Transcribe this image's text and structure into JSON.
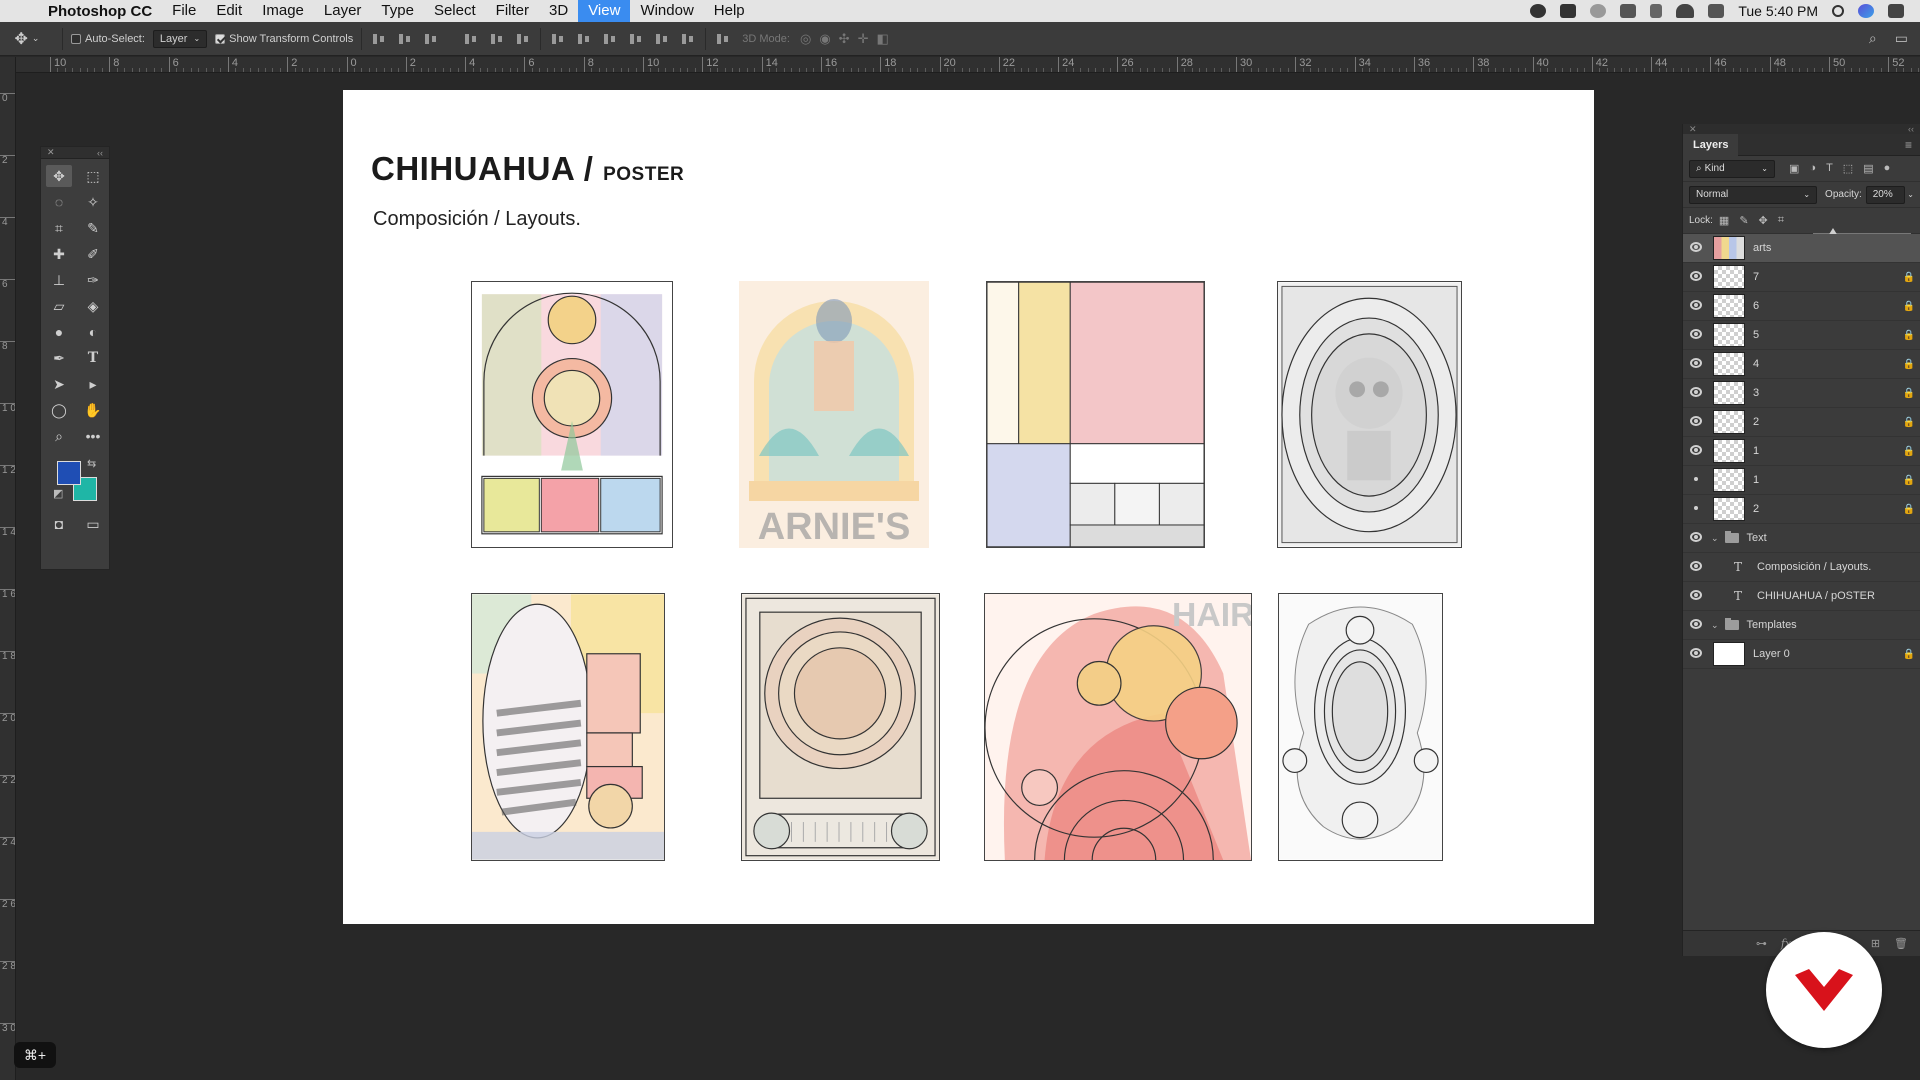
{
  "menubar": {
    "app_name": "Photoshop CC",
    "menus": [
      "File",
      "Edit",
      "Image",
      "Layer",
      "Type",
      "Select",
      "Filter",
      "3D",
      "View",
      "Window",
      "Help"
    ],
    "active_menu": "View",
    "clock": "Tue 5:40 PM"
  },
  "options_bar": {
    "auto_select_label": "Auto-Select:",
    "auto_select_target": "Layer",
    "show_transform_label": "Show Transform Controls",
    "mode_3d_label": "3D Mode:"
  },
  "rulers": {
    "horizontal_labels": [
      "10",
      "8",
      "6",
      "4",
      "2",
      "0",
      "2",
      "4",
      "6",
      "8",
      "10",
      "12",
      "14",
      "16",
      "18",
      "20",
      "22",
      "24",
      "26",
      "28",
      "30",
      "32",
      "34",
      "36",
      "38",
      "40",
      "42",
      "44",
      "46",
      "48",
      "50",
      "52"
    ],
    "vertical_labels": [
      "0",
      "2",
      "4",
      "6",
      "8",
      "1 0",
      "1 2",
      "1 4",
      "1 6",
      "1 8",
      "2 0",
      "2 2",
      "2 4",
      "2 6",
      "2 8",
      "3 0",
      "3 2"
    ]
  },
  "document": {
    "title_main": "CHIHUAHUA / ",
    "title_small": "POSTER",
    "subtitle": "Composición / Layouts.",
    "poster_text_arnies": "ARNIE'S",
    "poster_text_hair": "HAIR"
  },
  "layers_panel": {
    "tab_label": "Layers",
    "filter_kind": "Kind",
    "blend_mode": "Normal",
    "opacity_label": "Opacity:",
    "opacity_value": "20%",
    "opacity_fraction": 0.2,
    "lock_label": "Lock:",
    "layers": [
      {
        "name": "arts",
        "visible": true,
        "locked": false,
        "selected": true,
        "kind": "image"
      },
      {
        "name": "7",
        "visible": true,
        "locked": true,
        "kind": "pixel"
      },
      {
        "name": "6",
        "visible": true,
        "locked": true,
        "kind": "pixel"
      },
      {
        "name": "5",
        "visible": true,
        "locked": true,
        "kind": "pixel"
      },
      {
        "name": "4",
        "visible": true,
        "locked": true,
        "kind": "pixel"
      },
      {
        "name": "3",
        "visible": true,
        "locked": true,
        "kind": "pixel"
      },
      {
        "name": "2",
        "visible": true,
        "locked": true,
        "kind": "pixel"
      },
      {
        "name": "1",
        "visible": true,
        "locked": true,
        "kind": "pixel"
      },
      {
        "name": "1",
        "visible": false,
        "locked": true,
        "kind": "pixel"
      },
      {
        "name": "2",
        "visible": false,
        "locked": true,
        "kind": "pixel"
      },
      {
        "name": "Text",
        "visible": true,
        "locked": false,
        "kind": "group"
      },
      {
        "name": "Composición / Layouts.",
        "visible": true,
        "locked": false,
        "kind": "text"
      },
      {
        "name": "CHIHUAHUA / pOSTER",
        "visible": true,
        "locked": false,
        "kind": "text"
      },
      {
        "name": "Templates",
        "visible": true,
        "locked": false,
        "kind": "group"
      },
      {
        "name": "Layer 0",
        "visible": true,
        "locked": true,
        "kind": "white"
      }
    ]
  },
  "colors": {
    "foreground": "#1f4eb4",
    "background": "#1fb6a6",
    "menu_highlight": "#3a8cf0",
    "logo_red": "#d8121b"
  },
  "shortcut_badge": "⌘+"
}
